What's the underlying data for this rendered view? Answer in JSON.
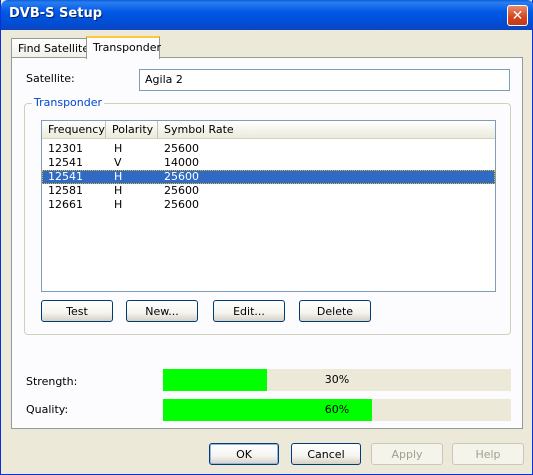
{
  "window": {
    "title": "DVB-S Setup",
    "close_glyph": "✕"
  },
  "tabs": [
    {
      "label": "Find Satellite",
      "active": false
    },
    {
      "label": "Transponder",
      "active": true
    }
  ],
  "satellite": {
    "label": "Satellite:",
    "value": "Agila 2"
  },
  "transponder_group": {
    "title": "Transponder"
  },
  "table": {
    "columns": [
      "Frequency",
      "Polarity",
      "Symbol Rate"
    ],
    "rows": [
      {
        "frequency": "12301",
        "polarity": "H",
        "symbol_rate": "25600"
      },
      {
        "frequency": "12541",
        "polarity": "V",
        "symbol_rate": "14000"
      },
      {
        "frequency": "12541",
        "polarity": "H",
        "symbol_rate": "25600",
        "selected": true
      },
      {
        "frequency": "12581",
        "polarity": "H",
        "symbol_rate": "25600"
      },
      {
        "frequency": "12661",
        "polarity": "H",
        "symbol_rate": "25600"
      }
    ]
  },
  "group_buttons": {
    "test": "Test",
    "new": "New...",
    "edit": "Edit...",
    "delete": "Delete"
  },
  "strength": {
    "label": "Strength:",
    "value": 30,
    "text": "30%"
  },
  "quality": {
    "label": "Quality:",
    "value": 60,
    "text": "60%"
  },
  "footer_buttons": {
    "ok": "OK",
    "cancel": "Cancel",
    "apply": "Apply",
    "help": "Help"
  },
  "colors": {
    "meter_fill": "#00ff00",
    "selection": "#316ac5",
    "titlebar": "#0058e6"
  }
}
